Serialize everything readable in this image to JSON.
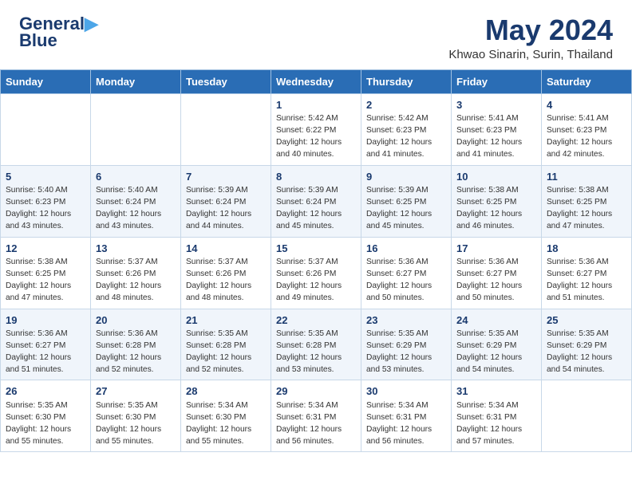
{
  "header": {
    "logo_line1": "General",
    "logo_line2": "Blue",
    "title": "May 2024",
    "location": "Khwao Sinarin, Surin, Thailand"
  },
  "weekdays": [
    "Sunday",
    "Monday",
    "Tuesday",
    "Wednesday",
    "Thursday",
    "Friday",
    "Saturday"
  ],
  "weeks": [
    [
      {
        "day": "",
        "info": ""
      },
      {
        "day": "",
        "info": ""
      },
      {
        "day": "",
        "info": ""
      },
      {
        "day": "1",
        "info": "Sunrise: 5:42 AM\nSunset: 6:22 PM\nDaylight: 12 hours\nand 40 minutes."
      },
      {
        "day": "2",
        "info": "Sunrise: 5:42 AM\nSunset: 6:23 PM\nDaylight: 12 hours\nand 41 minutes."
      },
      {
        "day": "3",
        "info": "Sunrise: 5:41 AM\nSunset: 6:23 PM\nDaylight: 12 hours\nand 41 minutes."
      },
      {
        "day": "4",
        "info": "Sunrise: 5:41 AM\nSunset: 6:23 PM\nDaylight: 12 hours\nand 42 minutes."
      }
    ],
    [
      {
        "day": "5",
        "info": "Sunrise: 5:40 AM\nSunset: 6:23 PM\nDaylight: 12 hours\nand 43 minutes."
      },
      {
        "day": "6",
        "info": "Sunrise: 5:40 AM\nSunset: 6:24 PM\nDaylight: 12 hours\nand 43 minutes."
      },
      {
        "day": "7",
        "info": "Sunrise: 5:39 AM\nSunset: 6:24 PM\nDaylight: 12 hours\nand 44 minutes."
      },
      {
        "day": "8",
        "info": "Sunrise: 5:39 AM\nSunset: 6:24 PM\nDaylight: 12 hours\nand 45 minutes."
      },
      {
        "day": "9",
        "info": "Sunrise: 5:39 AM\nSunset: 6:25 PM\nDaylight: 12 hours\nand 45 minutes."
      },
      {
        "day": "10",
        "info": "Sunrise: 5:38 AM\nSunset: 6:25 PM\nDaylight: 12 hours\nand 46 minutes."
      },
      {
        "day": "11",
        "info": "Sunrise: 5:38 AM\nSunset: 6:25 PM\nDaylight: 12 hours\nand 47 minutes."
      }
    ],
    [
      {
        "day": "12",
        "info": "Sunrise: 5:38 AM\nSunset: 6:25 PM\nDaylight: 12 hours\nand 47 minutes."
      },
      {
        "day": "13",
        "info": "Sunrise: 5:37 AM\nSunset: 6:26 PM\nDaylight: 12 hours\nand 48 minutes."
      },
      {
        "day": "14",
        "info": "Sunrise: 5:37 AM\nSunset: 6:26 PM\nDaylight: 12 hours\nand 48 minutes."
      },
      {
        "day": "15",
        "info": "Sunrise: 5:37 AM\nSunset: 6:26 PM\nDaylight: 12 hours\nand 49 minutes."
      },
      {
        "day": "16",
        "info": "Sunrise: 5:36 AM\nSunset: 6:27 PM\nDaylight: 12 hours\nand 50 minutes."
      },
      {
        "day": "17",
        "info": "Sunrise: 5:36 AM\nSunset: 6:27 PM\nDaylight: 12 hours\nand 50 minutes."
      },
      {
        "day": "18",
        "info": "Sunrise: 5:36 AM\nSunset: 6:27 PM\nDaylight: 12 hours\nand 51 minutes."
      }
    ],
    [
      {
        "day": "19",
        "info": "Sunrise: 5:36 AM\nSunset: 6:27 PM\nDaylight: 12 hours\nand 51 minutes."
      },
      {
        "day": "20",
        "info": "Sunrise: 5:36 AM\nSunset: 6:28 PM\nDaylight: 12 hours\nand 52 minutes."
      },
      {
        "day": "21",
        "info": "Sunrise: 5:35 AM\nSunset: 6:28 PM\nDaylight: 12 hours\nand 52 minutes."
      },
      {
        "day": "22",
        "info": "Sunrise: 5:35 AM\nSunset: 6:28 PM\nDaylight: 12 hours\nand 53 minutes."
      },
      {
        "day": "23",
        "info": "Sunrise: 5:35 AM\nSunset: 6:29 PM\nDaylight: 12 hours\nand 53 minutes."
      },
      {
        "day": "24",
        "info": "Sunrise: 5:35 AM\nSunset: 6:29 PM\nDaylight: 12 hours\nand 54 minutes."
      },
      {
        "day": "25",
        "info": "Sunrise: 5:35 AM\nSunset: 6:29 PM\nDaylight: 12 hours\nand 54 minutes."
      }
    ],
    [
      {
        "day": "26",
        "info": "Sunrise: 5:35 AM\nSunset: 6:30 PM\nDaylight: 12 hours\nand 55 minutes."
      },
      {
        "day": "27",
        "info": "Sunrise: 5:35 AM\nSunset: 6:30 PM\nDaylight: 12 hours\nand 55 minutes."
      },
      {
        "day": "28",
        "info": "Sunrise: 5:34 AM\nSunset: 6:30 PM\nDaylight: 12 hours\nand 55 minutes."
      },
      {
        "day": "29",
        "info": "Sunrise: 5:34 AM\nSunset: 6:31 PM\nDaylight: 12 hours\nand 56 minutes."
      },
      {
        "day": "30",
        "info": "Sunrise: 5:34 AM\nSunset: 6:31 PM\nDaylight: 12 hours\nand 56 minutes."
      },
      {
        "day": "31",
        "info": "Sunrise: 5:34 AM\nSunset: 6:31 PM\nDaylight: 12 hours\nand 57 minutes."
      },
      {
        "day": "",
        "info": ""
      }
    ]
  ]
}
